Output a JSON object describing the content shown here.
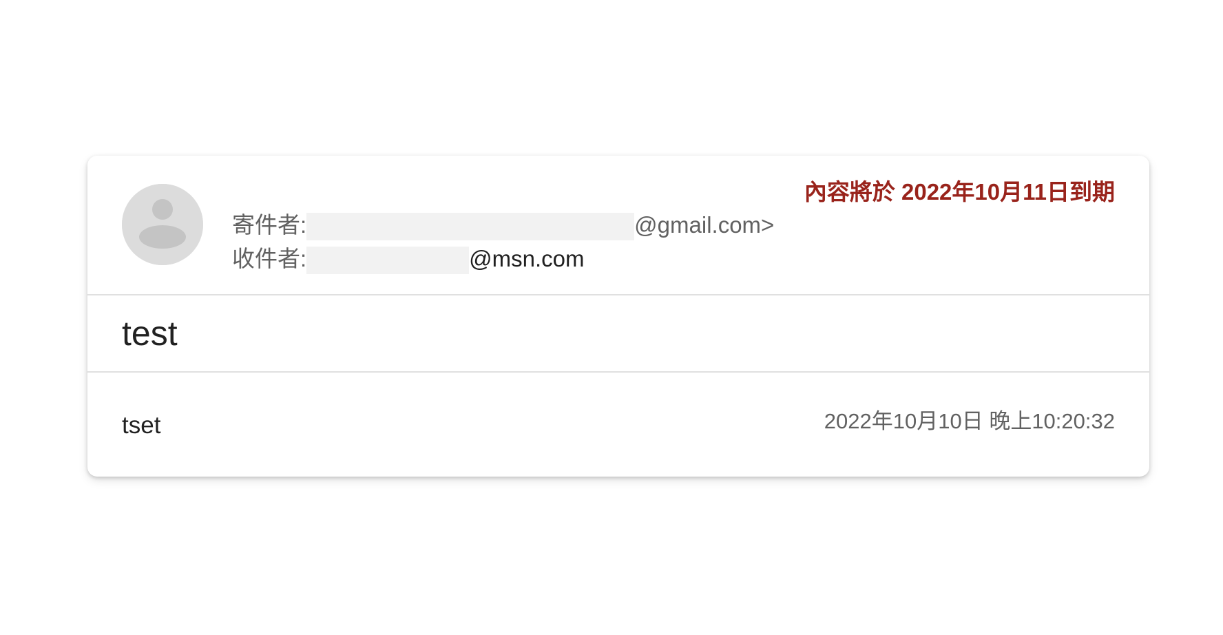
{
  "message": {
    "expiry_notice": "內容將於 2022年10月11日到期",
    "sender": {
      "label": "寄件者:",
      "address_suffix": "@gmail.com>"
    },
    "recipient": {
      "label": "收件者:",
      "address_suffix": "@msn.com"
    },
    "subject": "test",
    "body": "tset",
    "timestamp": "2022年10月10日 晚上10:20:32"
  },
  "colors": {
    "expiry_text": "#99231b",
    "secondary_text": "#616161",
    "primary_text": "#212121",
    "divider": "#e0e0e0",
    "avatar_bg": "#dcdcdc",
    "redaction": "#f2f2f2"
  },
  "icons": {
    "avatar": "default-person-icon"
  }
}
